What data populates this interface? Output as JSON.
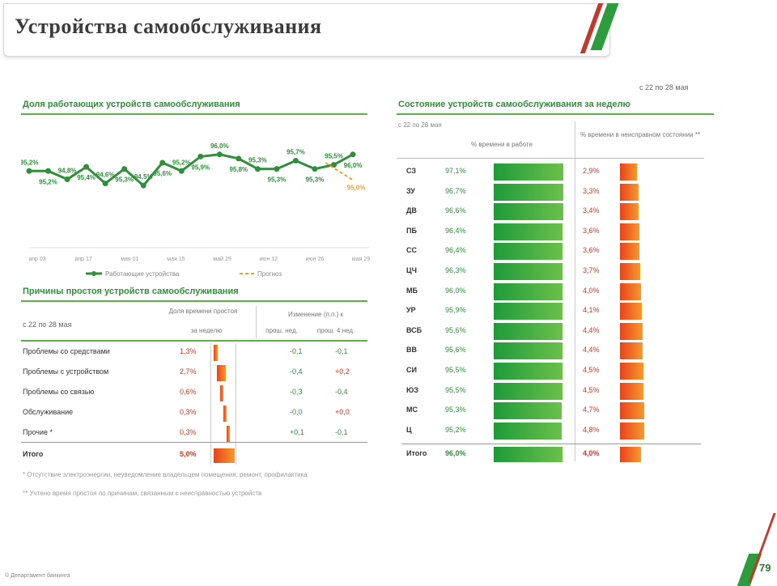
{
  "header": {
    "title": "Устройства самообслуживания"
  },
  "page_number": "79",
  "copyright": "© Департамент банкинга",
  "period_note": "с 22 по 28 мая",
  "left_top": {
    "title": "Доля работающих устройств самообслуживания",
    "legend": {
      "series1": "Работающие устройства",
      "series2": "Прогноз"
    }
  },
  "left_bottom": {
    "title": "Причины простоя устройств самообслуживания",
    "period": "с 22 по 28 мая",
    "group1_label": "Доля времени простоя",
    "group1_sub": "за неделю",
    "group2_label": "Изменение (п.п.) к",
    "group2_sub1": "прош. нед.",
    "group2_sub2": "прош. 4 нед.",
    "rows": [
      {
        "label": "Проблемы со средствами",
        "share": "1,3%",
        "d1": "-0,1",
        "d2": "-0,1"
      },
      {
        "label": "Проблемы с устройством",
        "share": "2,7%",
        "d1": "-0,4",
        "d2": "+0,2"
      },
      {
        "label": "Проблемы со связью",
        "share": "0,6%",
        "d1": "-0,3",
        "d2": "-0,4"
      },
      {
        "label": "Обслуживание",
        "share": "0,3%",
        "d1": "-0,0",
        "d2": "+0,0"
      },
      {
        "label": "Прочие *",
        "share": "0,3%",
        "d1": "+0,1",
        "d2": "-0,1"
      }
    ],
    "total": {
      "label": "Итого",
      "share": "5,0%"
    }
  },
  "right": {
    "title": "Состояние устройств самообслуживания за неделю",
    "period": "с 22 по 28 мая",
    "col1_header": "% времени в работе",
    "col2_header": "% времени в неисправном состоянии **",
    "rows": [
      {
        "code": "СЗ",
        "work": "97,1%",
        "fail": "2,9%"
      },
      {
        "code": "ЗУ",
        "work": "96,7%",
        "fail": "3,3%"
      },
      {
        "code": "ДВ",
        "work": "96,6%",
        "fail": "3,4%"
      },
      {
        "code": "ПБ",
        "work": "96,4%",
        "fail": "3,6%"
      },
      {
        "code": "СС",
        "work": "96,4%",
        "fail": "3,6%"
      },
      {
        "code": "ЦЧ",
        "work": "96,3%",
        "fail": "3,7%"
      },
      {
        "code": "МБ",
        "work": "96,0%",
        "fail": "4,0%"
      },
      {
        "code": "УР",
        "work": "95,9%",
        "fail": "4,1%"
      },
      {
        "code": "ВСБ",
        "work": "95,6%",
        "fail": "4,4%"
      },
      {
        "code": "ВВ",
        "work": "95,6%",
        "fail": "4,4%"
      },
      {
        "code": "СИ",
        "work": "95,5%",
        "fail": "4,5%"
      },
      {
        "code": "ЮЗ",
        "work": "95,5%",
        "fail": "4,5%"
      },
      {
        "code": "МС",
        "work": "95,3%",
        "fail": "4,7%"
      },
      {
        "code": "Ц",
        "work": "95,2%",
        "fail": "4,8%"
      }
    ],
    "total": {
      "code": "Итого",
      "work": "96,0%",
      "fail": "4,0%"
    }
  },
  "footnotes": [
    "* Отсутствие электроэнергии, неуведомление владельцем помещения, ремонт, профилактика",
    "** Учтено время простоя по причинам, связанным с неисправностью устройств"
  ],
  "colors": {
    "green": "#2f8f3a",
    "light_green": "#6cc04a",
    "red": "#e0301e",
    "orange": "#f59a2c"
  },
  "chart_data": {
    "type": "line",
    "title": "Доля работающих устройств самообслуживания",
    "x": [
      "апр 03",
      "апр 10",
      "апр 17",
      "апр 24",
      "мая 01",
      "мая 08",
      "мая 15",
      "мая 22",
      "мая 29"
    ],
    "tick_labels": [
      "апр 03",
      "апр 17",
      "мая 01",
      "мая 15",
      "май 29",
      "июн 12",
      "июн 26",
      "мая 29"
    ],
    "series": [
      {
        "name": "Работающие устройства",
        "color": "#2f8f3a",
        "values": [
          95.2,
          95.2,
          94.8,
          95.4,
          94.6,
          95.3,
          94.5,
          95.6,
          95.2,
          95.9,
          96.0,
          95.8,
          95.3,
          95.3,
          95.7,
          95.3,
          95.5,
          96.0
        ],
        "labels": [
          "95,2%",
          "95,2%",
          "94,8%",
          "95,4%",
          "94,6%",
          "95,3%",
          "94,5%",
          "95,6%",
          "95,2%",
          "95,9%",
          "96,0%",
          "95,8%",
          "95,3%",
          "95,3%",
          "95,7%",
          "95,3%",
          "95,5%",
          "96,0%"
        ]
      },
      {
        "name": "Прогноз",
        "color": "#f0a030",
        "values": [
          95.6,
          95.0
        ],
        "labels": [
          "",
          "95,0%"
        ]
      }
    ],
    "legend": "bottom"
  }
}
